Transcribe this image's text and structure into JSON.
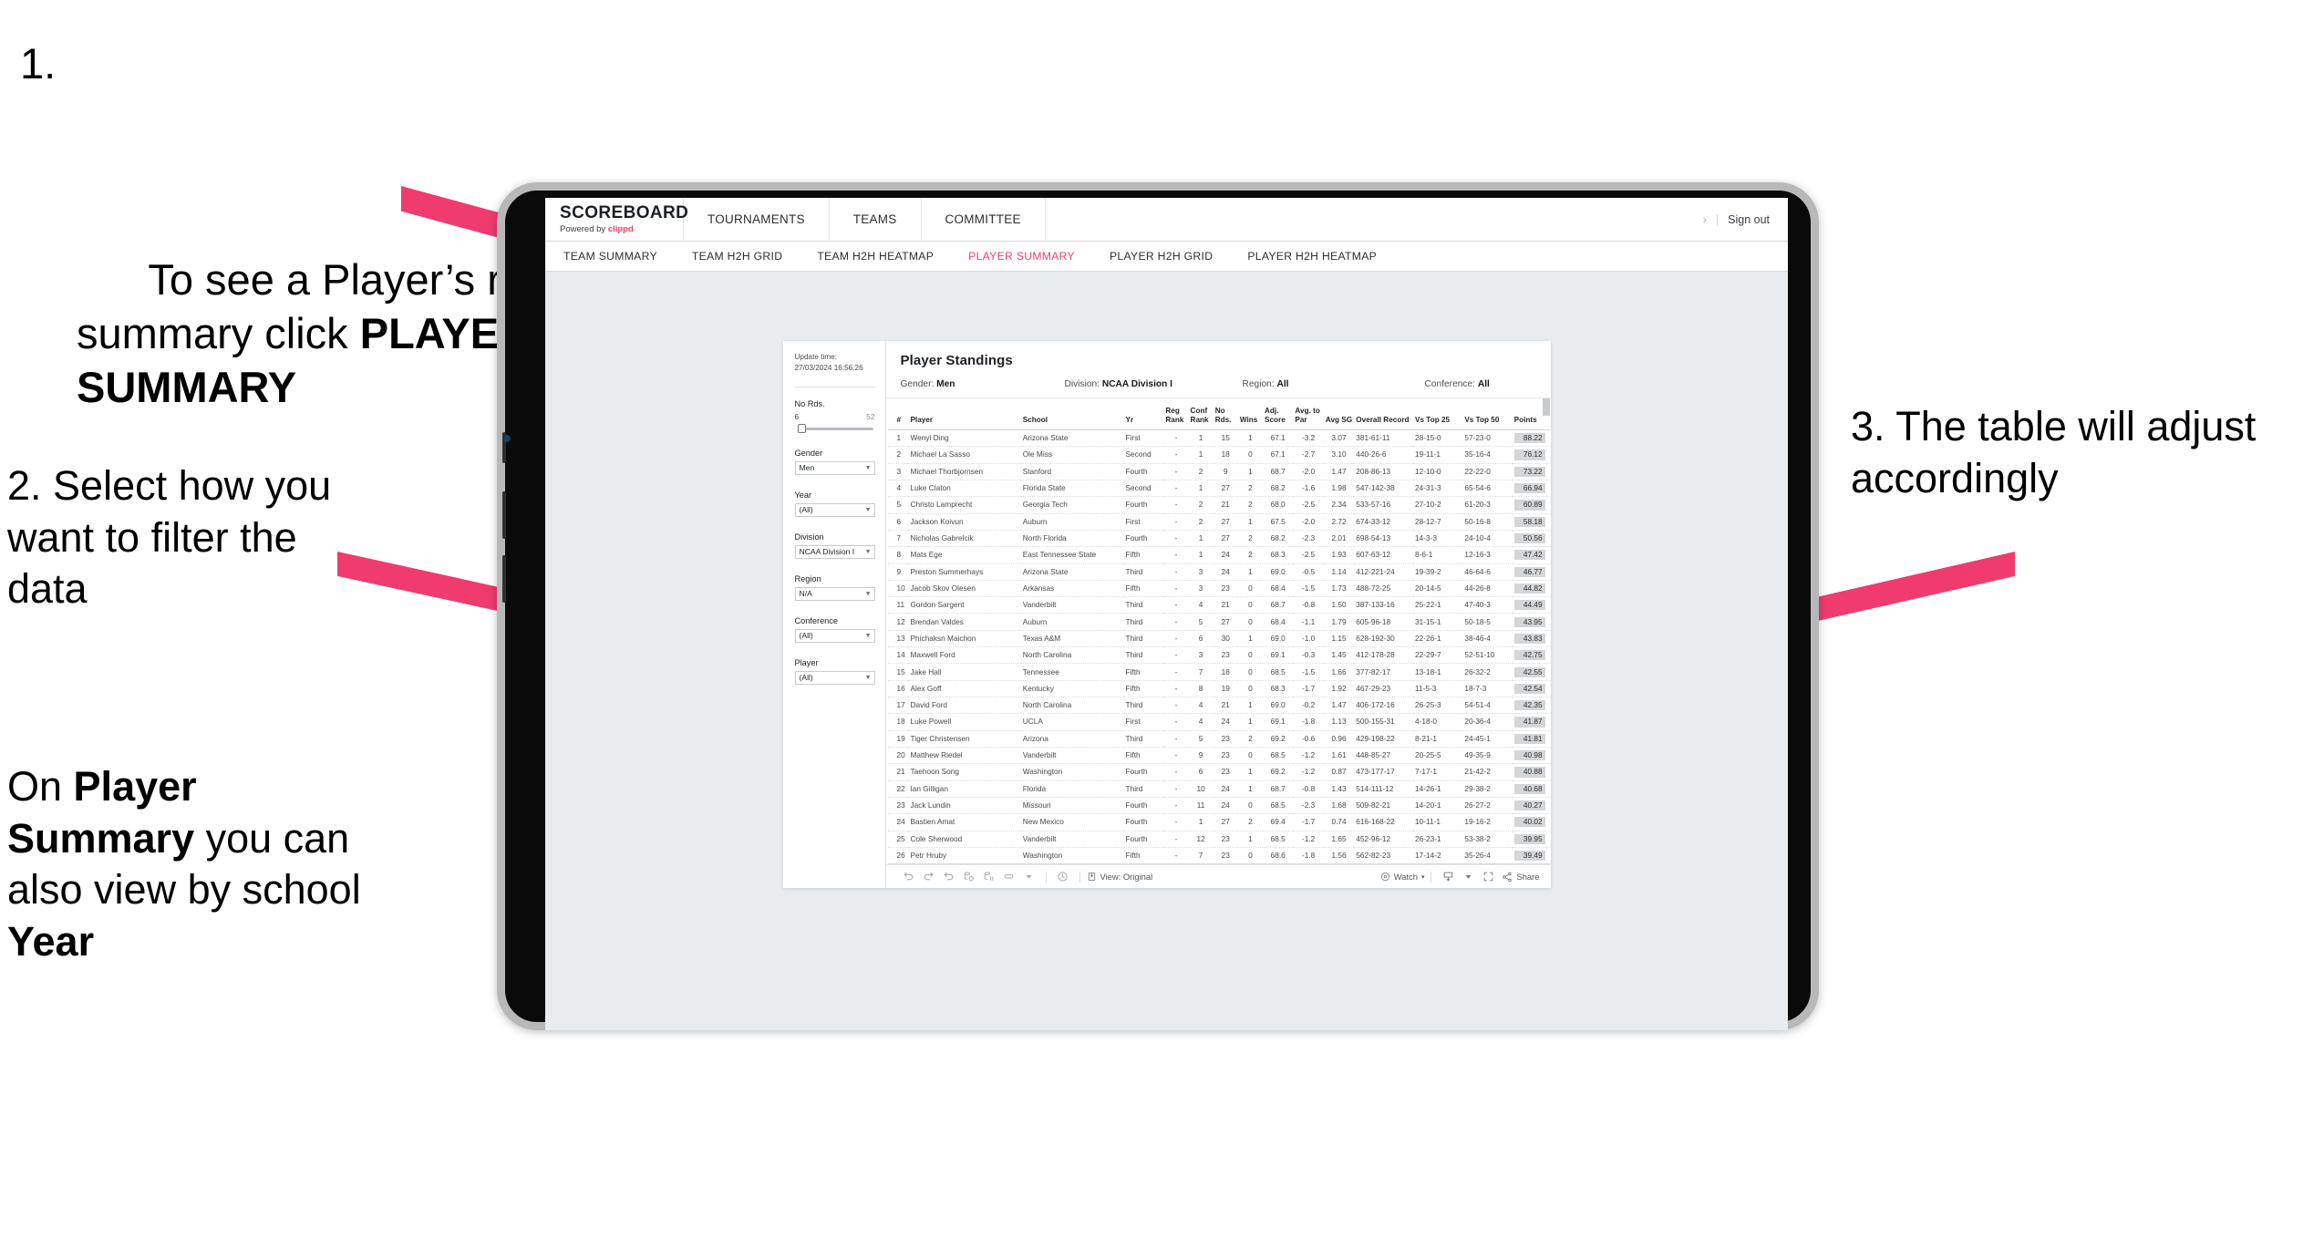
{
  "annotations": {
    "step1": {
      "number": "1.",
      "text_before": "To see a Player’s rankings summary click ",
      "bold": "PLAYER SUMMARY"
    },
    "step2": {
      "line": "2. Select how you want to filter the data"
    },
    "step2b": {
      "before": "On ",
      "bold1": "Player Summary",
      "middle": " you can also view by school ",
      "bold2": "Year"
    },
    "step3": {
      "line": "3. The table will adjust accordingly"
    }
  },
  "app": {
    "brand": {
      "title": "SCOREBOARD",
      "sub_prefix": "Powered by ",
      "sub_brand": "clippd"
    },
    "topnav": [
      "TOURNAMENTS",
      "TEAMS",
      "COMMITTEE"
    ],
    "account": {
      "chevron": "›",
      "separator": "|",
      "signout": "Sign out"
    },
    "subnav": {
      "tabs": [
        "TEAM SUMMARY",
        "TEAM H2H GRID",
        "TEAM H2H HEATMAP",
        "PLAYER SUMMARY",
        "PLAYER H2H GRID",
        "PLAYER H2H HEATMAP"
      ],
      "active": "PLAYER SUMMARY"
    }
  },
  "viz": {
    "update_label": "Update time:",
    "update_time": "27/03/2024 16:56:26",
    "title": "Player Standings",
    "header_filters": [
      {
        "label": "Gender:",
        "value": "Men"
      },
      {
        "label": "Division:",
        "value": "NCAA Division I"
      },
      {
        "label": "Region:",
        "value": "All"
      },
      {
        "label": "Conference:",
        "value": "All"
      }
    ],
    "filters": {
      "slider": {
        "label": "No Rds.",
        "min": "6",
        "max": "52"
      },
      "selects": [
        {
          "label": "Gender",
          "value": "Men"
        },
        {
          "label": "Year",
          "value": "(All)"
        },
        {
          "label": "Division",
          "value": "NCAA Division I"
        },
        {
          "label": "Region",
          "value": "N/A"
        },
        {
          "label": "Conference",
          "value": "(All)"
        },
        {
          "label": "Player",
          "value": "(All)"
        }
      ]
    },
    "toolbar": {
      "view_label": "View: Original",
      "watch_label": "Watch",
      "share_label": "Share",
      "caret": "▾"
    }
  },
  "table": {
    "columns": [
      "#",
      "Player",
      "School",
      "Yr",
      "Reg Rank",
      "Conf Rank",
      "No Rds.",
      "Wins",
      "Adj. Score",
      "Avg. to Par",
      "Avg SG",
      "Overall Record",
      "Vs Top 25",
      "Vs Top 50",
      "Points"
    ],
    "rows": [
      [
        "1",
        "Wenyi Ding",
        "Arizona State",
        "First",
        "-",
        "1",
        "15",
        "1",
        "67.1",
        "-3.2",
        "3.07",
        "381-61-11",
        "28-15-0",
        "57-23-0",
        "88.22"
      ],
      [
        "2",
        "Michael La Sasso",
        "Ole Miss",
        "Second",
        "-",
        "1",
        "18",
        "0",
        "67.1",
        "-2.7",
        "3.10",
        "440-26-6",
        "19-11-1",
        "35-16-4",
        "76.12"
      ],
      [
        "3",
        "Michael Thorbjornsen",
        "Stanford",
        "Fourth",
        "-",
        "2",
        "9",
        "1",
        "68.7",
        "-2.0",
        "1.47",
        "208-86-13",
        "12-10-0",
        "22-22-0",
        "73.22"
      ],
      [
        "4",
        "Luke Claton",
        "Florida State",
        "Second",
        "-",
        "1",
        "27",
        "2",
        "68.2",
        "-1.6",
        "1.98",
        "547-142-38",
        "24-31-3",
        "65-54-6",
        "66.94"
      ],
      [
        "5",
        "Christo Lamprecht",
        "Georgia Tech",
        "Fourth",
        "-",
        "2",
        "21",
        "2",
        "68.0",
        "-2.5",
        "2.34",
        "533-57-16",
        "27-10-2",
        "61-20-3",
        "60.89"
      ],
      [
        "6",
        "Jackson Koivun",
        "Auburn",
        "First",
        "-",
        "2",
        "27",
        "1",
        "67.5",
        "-2.0",
        "2.72",
        "674-33-12",
        "28-12-7",
        "50-16-8",
        "58.18"
      ],
      [
        "7",
        "Nicholas Gabrelcik",
        "North Florida",
        "Fourth",
        "-",
        "1",
        "27",
        "2",
        "68.2",
        "-2.3",
        "2.01",
        "698-54-13",
        "14-3-3",
        "24-10-4",
        "50.56"
      ],
      [
        "8",
        "Mats Ege",
        "East Tennessee State",
        "Fifth",
        "-",
        "1",
        "24",
        "2",
        "68.3",
        "-2.5",
        "1.93",
        "607-63-12",
        "8-6-1",
        "12-16-3",
        "47.42"
      ],
      [
        "9",
        "Preston Summerhays",
        "Arizona State",
        "Third",
        "-",
        "3",
        "24",
        "1",
        "69.0",
        "-0.5",
        "1.14",
        "412-221-24",
        "19-39-2",
        "46-64-6",
        "46.77"
      ],
      [
        "10",
        "Jacob Skov Olesen",
        "Arkansas",
        "Fifth",
        "-",
        "3",
        "23",
        "0",
        "68.4",
        "-1.5",
        "1.73",
        "488-72-25",
        "20-14-5",
        "44-26-8",
        "44.82"
      ],
      [
        "11",
        "Gordon Sargent",
        "Vanderbilt",
        "Third",
        "-",
        "4",
        "21",
        "0",
        "68.7",
        "-0.8",
        "1.50",
        "387-133-16",
        "25-22-1",
        "47-40-3",
        "44.49"
      ],
      [
        "12",
        "Brendan Valdes",
        "Auburn",
        "Third",
        "-",
        "5",
        "27",
        "0",
        "68.4",
        "-1.1",
        "1.79",
        "605-96-18",
        "31-15-1",
        "50-18-5",
        "43.95"
      ],
      [
        "13",
        "Phichaksn Maichon",
        "Texas A&M",
        "Third",
        "-",
        "6",
        "30",
        "1",
        "69.0",
        "-1.0",
        "1.15",
        "628-192-30",
        "22-26-1",
        "38-46-4",
        "43.83"
      ],
      [
        "14",
        "Maxwell Ford",
        "North Carolina",
        "Third",
        "-",
        "3",
        "23",
        "0",
        "69.1",
        "-0.3",
        "1.45",
        "412-178-28",
        "22-29-7",
        "52-51-10",
        "42.75"
      ],
      [
        "15",
        "Jake Hall",
        "Tennessee",
        "Fifth",
        "-",
        "7",
        "18",
        "0",
        "68.5",
        "-1.5",
        "1.66",
        "377-82-17",
        "13-18-1",
        "26-32-2",
        "42.55"
      ],
      [
        "16",
        "Alex Goff",
        "Kentucky",
        "Fifth",
        "-",
        "8",
        "19",
        "0",
        "68.3",
        "-1.7",
        "1.92",
        "467-29-23",
        "11-5-3",
        "18-7-3",
        "42.54"
      ],
      [
        "17",
        "David Ford",
        "North Carolina",
        "Third",
        "-",
        "4",
        "21",
        "1",
        "69.0",
        "-0.2",
        "1.47",
        "406-172-16",
        "26-25-3",
        "54-51-4",
        "42.35"
      ],
      [
        "18",
        "Luke Powell",
        "UCLA",
        "First",
        "-",
        "4",
        "24",
        "1",
        "69.1",
        "-1.8",
        "1.13",
        "500-155-31",
        "4-18-0",
        "20-36-4",
        "41.87"
      ],
      [
        "19",
        "Tiger Christensen",
        "Arizona",
        "Third",
        "-",
        "5",
        "23",
        "2",
        "69.2",
        "-0.6",
        "0.96",
        "429-198-22",
        "8-21-1",
        "24-45-1",
        "41.81"
      ],
      [
        "20",
        "Matthew Riedel",
        "Vanderbilt",
        "Fifth",
        "-",
        "9",
        "23",
        "0",
        "68.5",
        "-1.2",
        "1.61",
        "448-85-27",
        "20-25-5",
        "49-35-9",
        "40.98"
      ],
      [
        "21",
        "Taehoon Song",
        "Washington",
        "Fourth",
        "-",
        "6",
        "23",
        "1",
        "69.2",
        "-1.2",
        "0.87",
        "473-177-17",
        "7-17-1",
        "21-42-2",
        "40.88"
      ],
      [
        "22",
        "Ian Gilligan",
        "Florida",
        "Third",
        "-",
        "10",
        "24",
        "1",
        "68.7",
        "-0.8",
        "1.43",
        "514-111-12",
        "14-26-1",
        "29-38-2",
        "40.68"
      ],
      [
        "23",
        "Jack Lundin",
        "Missouri",
        "Fourth",
        "-",
        "11",
        "24",
        "0",
        "68.5",
        "-2.3",
        "1.68",
        "509-82-21",
        "14-20-1",
        "26-27-2",
        "40.27"
      ],
      [
        "24",
        "Bastien Amat",
        "New Mexico",
        "Fourth",
        "-",
        "1",
        "27",
        "2",
        "69.4",
        "-1.7",
        "0.74",
        "616-168-22",
        "10-11-1",
        "19-16-2",
        "40.02"
      ],
      [
        "25",
        "Cole Sherwood",
        "Vanderbilt",
        "Fourth",
        "-",
        "12",
        "23",
        "1",
        "68.5",
        "-1.2",
        "1.65",
        "452-96-12",
        "26-23-1",
        "53-38-2",
        "39.95"
      ],
      [
        "26",
        "Petr Hruby",
        "Washington",
        "Fifth",
        "-",
        "7",
        "23",
        "0",
        "68.6",
        "-1.8",
        "1.56",
        "562-82-23",
        "17-14-2",
        "35-26-4",
        "39.49"
      ]
    ]
  },
  "colors": {
    "accent_pink": "#f0406d",
    "arrow_pink": "#ef3b6e",
    "brand_pink": "#ef3b67"
  }
}
